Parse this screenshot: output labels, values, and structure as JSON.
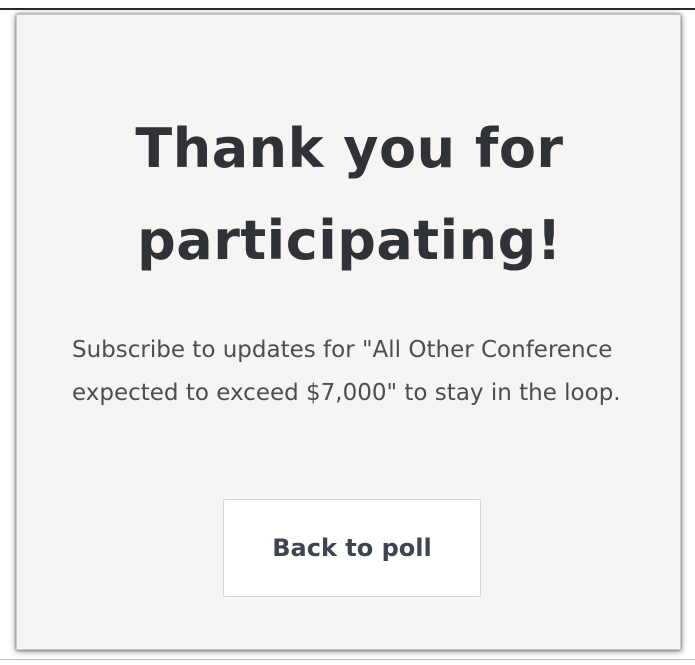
{
  "card": {
    "title": "Thank you for participating!",
    "message": "Subscribe to updates for \"All Other Conference expected to exceed $7,000\" to stay in the loop.",
    "button_label": "Back to poll"
  }
}
